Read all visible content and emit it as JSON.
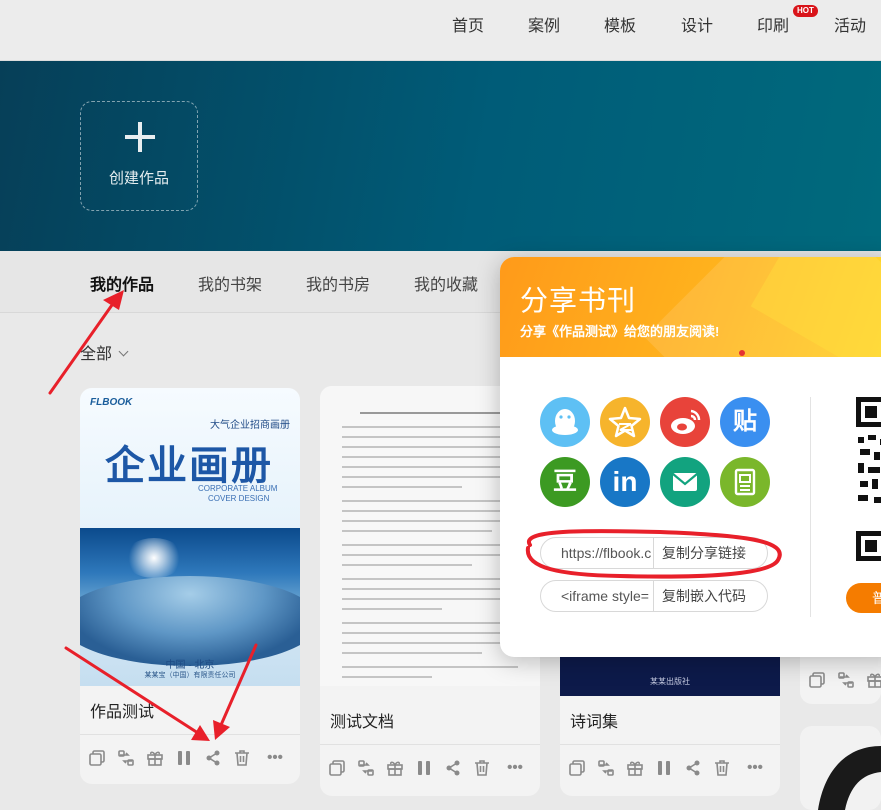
{
  "nav": {
    "items": [
      "首页",
      "案例",
      "模板",
      "设计",
      "印刷",
      "活动"
    ],
    "hot_badge": "HOT"
  },
  "hero": {
    "create_label": "创建作品"
  },
  "tabs": [
    "我的作品",
    "我的书架",
    "我的书房",
    "我的收藏"
  ],
  "filter": {
    "label": "全部"
  },
  "cards": [
    {
      "title": "作品测试",
      "cover": {
        "brand": "FLBOOK",
        "subtitle": "大气企业招商画册",
        "title": "企业画册",
        "en_line1": "CORPORATE ALBUM",
        "en_line2": "COVER DESIGN",
        "city": "中国 · 北京",
        "company": "某某宝（中国）有限责任公司"
      }
    },
    {
      "title": "测试文档"
    },
    {
      "title": "诗词集",
      "cover": {
        "publisher": "某某出版社"
      }
    }
  ],
  "share_popup": {
    "title": "分享书刊",
    "subtitle": "分享《作品测试》给您的朋友阅读!",
    "icons": [
      "qq-icon",
      "qzone-icon",
      "weibo-icon",
      "tieba-icon",
      "douban-icon",
      "linkedin-icon",
      "email-icon",
      "notes-icon"
    ],
    "tieba_glyph": "贴",
    "douban_glyph": "豆",
    "linkedin_glyph": "in",
    "link_field": {
      "value": "https://flbook.c",
      "button": "复制分享链接"
    },
    "embed_field": {
      "value": "<iframe style=",
      "button": "复制嵌入代码"
    },
    "qr_button": "普"
  },
  "colors": {
    "hero": "#005c78",
    "share_header": "#ffb21d",
    "annotation_red": "#e8202a",
    "qr_button": "#f57c00"
  }
}
